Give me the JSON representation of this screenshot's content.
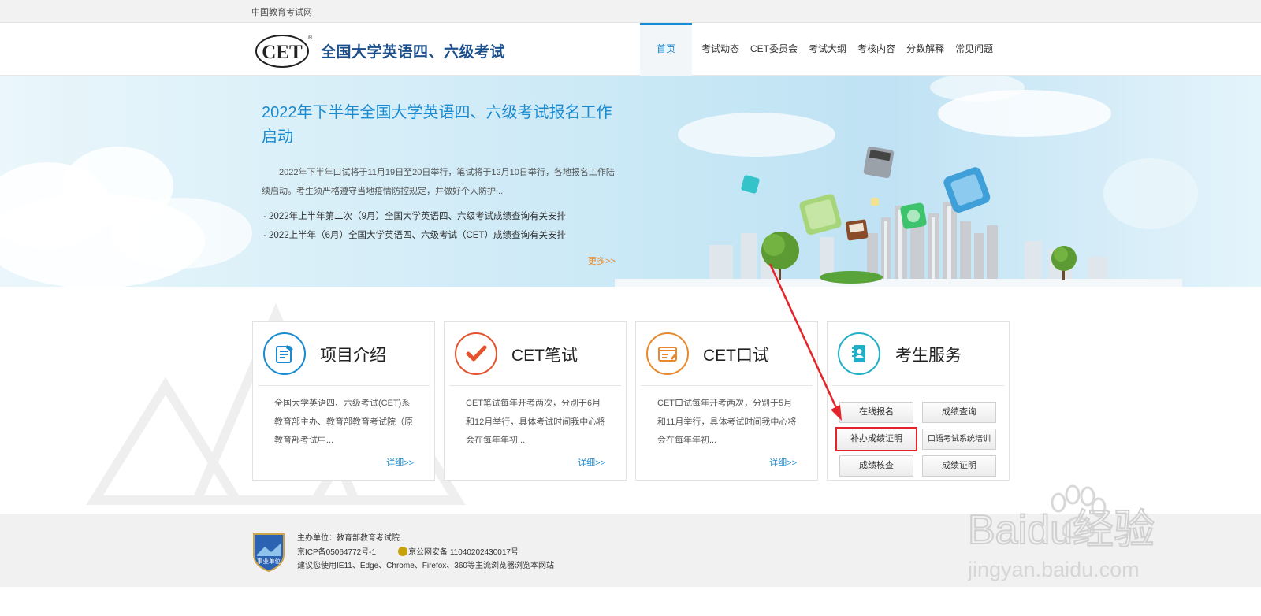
{
  "topbar": {
    "site_name": "中国教育考试网"
  },
  "header": {
    "logo_text": "CET",
    "title": "全国大学英语四、六级考试",
    "nav": [
      "首页",
      "考试动态",
      "CET委员会",
      "考试大纲",
      "考核内容",
      "分数解释",
      "常见问题"
    ]
  },
  "banner": {
    "headline": "2022年下半年全国大学英语四、六级考试报名工作启动",
    "summary": "2022年下半年口试将于11月19日至20日举行，笔试将于12月10日举行，各地报名工作陆续启动。考生须严格遵守当地疫情防控规定，并做好个人防护...",
    "news": [
      "· 2022年上半年第二次（9月）全国大学英语四、六级考试成绩查询有关安排",
      "· 2022上半年（6月）全国大学英语四、六级考试（CET）成绩查询有关安排"
    ],
    "more": "更多>>"
  },
  "cards": [
    {
      "title": "项目介绍",
      "icon": "document-icon",
      "color": "#1a8bd0",
      "desc": "全国大学英语四、六级考试(CET)系教育部主办、教育部教育考试院（原教育部考试中...",
      "detail": "详细>>"
    },
    {
      "title": "CET笔试",
      "icon": "checkmark-icon",
      "color": "#e4532d",
      "desc": "CET笔试每年开考两次，分别于6月和12月举行，具体考试时间我中心将会在每年年初...",
      "detail": "详细>>"
    },
    {
      "title": "CET口试",
      "icon": "screen-edit-icon",
      "color": "#e8892e",
      "desc": "CET口试每年开考两次，分别于5月和11月举行，具体考试时间我中心将会在每年年初...",
      "detail": "详细>>"
    }
  ],
  "services": {
    "title": "考生服务",
    "icon": "contacts-book-icon",
    "color": "#1fb0c8",
    "buttons": [
      "在线报名",
      "成绩查询",
      "补办成绩证明",
      "口语考试系统培训",
      "成绩核查",
      "成绩证明"
    ]
  },
  "footer": {
    "badge_text": "事业单位",
    "host": "主办单位：教育部教育考试院",
    "icp": "京ICP备05064772号-1",
    "police": "京公网安备 11040202430017号",
    "browser_tip": "建议您使用IE11、Edge、Chrome、Firefox、360等主流浏览器浏览本网站"
  },
  "watermark": {
    "brand": "Baidu经验",
    "url": "jingyan.baidu.com"
  }
}
